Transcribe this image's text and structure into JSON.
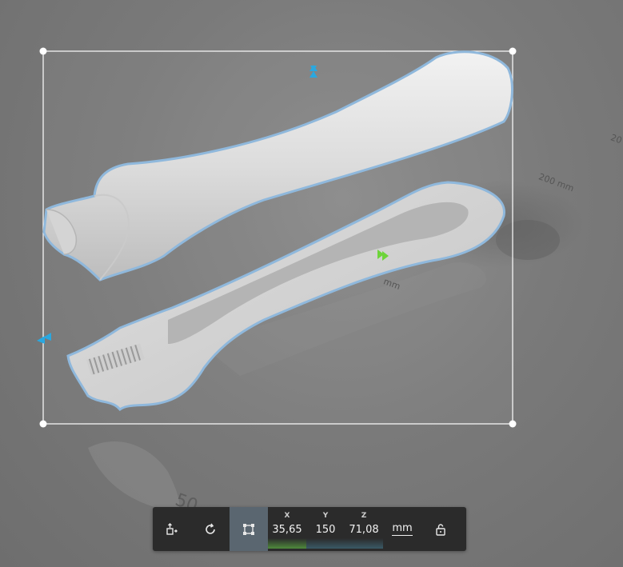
{
  "viewport": {
    "ruler_labels": [
      "200 mm",
      "20",
      "mm",
      "50"
    ]
  },
  "toolbar": {
    "buttons": [
      {
        "name": "move-to-bed",
        "icon": "place-on-bed-icon"
      },
      {
        "name": "rotate",
        "icon": "rotate-icon"
      },
      {
        "name": "scale",
        "icon": "scale-icon",
        "active": true
      }
    ],
    "x_label": "X",
    "y_label": "Y",
    "z_label": "Z",
    "x_value": "35,65",
    "y_value": "150",
    "z_value": "71,08",
    "unit": "mm",
    "lock_icon": "unlock-icon",
    "colors": {
      "toolbar_bg": "#2b2b2b",
      "active_bg": "#5a6670",
      "x_bar": "#4f8a3c",
      "y_bar": "#3a5a66",
      "z_bar": "#3a5a66",
      "selection_outline": "#8fb8dc",
      "handle_blue": "#2aa8e0",
      "handle_green": "#6dd43a"
    }
  }
}
